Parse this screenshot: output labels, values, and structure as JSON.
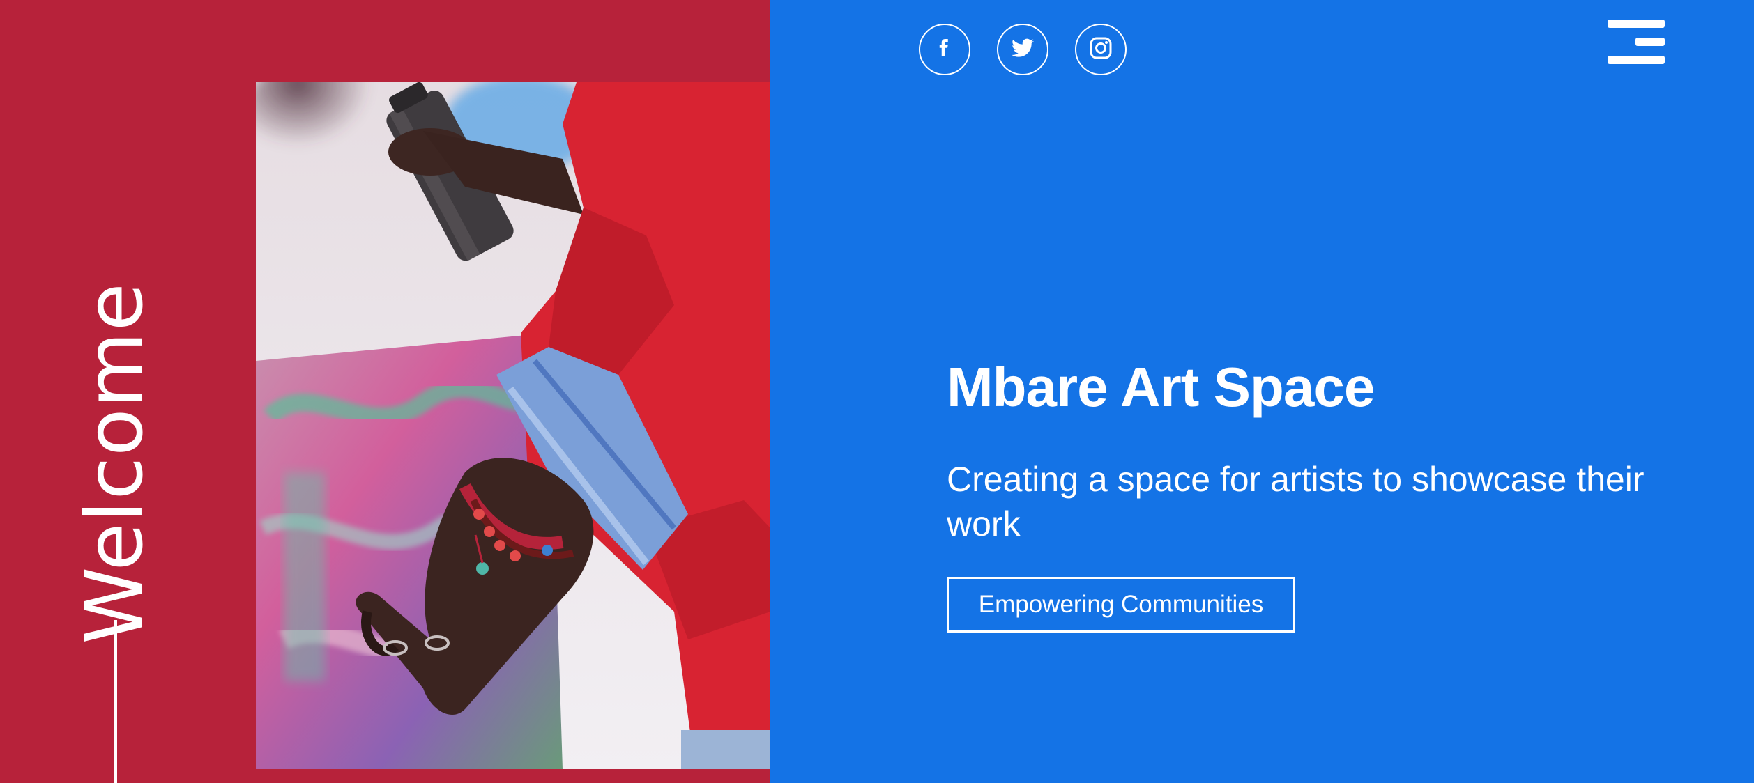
{
  "colors": {
    "left_panel": "#b7223a",
    "right_panel": "#1473e6",
    "text": "#ffffff"
  },
  "sidebar": {
    "welcome": "Welcome"
  },
  "header": {
    "social": [
      {
        "name": "facebook",
        "icon": "facebook-icon"
      },
      {
        "name": "twitter",
        "icon": "twitter-icon"
      },
      {
        "name": "instagram",
        "icon": "instagram-icon"
      }
    ],
    "menu_icon": "hamburger-menu-icon"
  },
  "hero": {
    "title": "Mbare Art Space",
    "subtitle": "Creating a space for artists to showcase their work",
    "cta_label": "Empowering Communities",
    "image": "artist-spray-painting-photo"
  }
}
